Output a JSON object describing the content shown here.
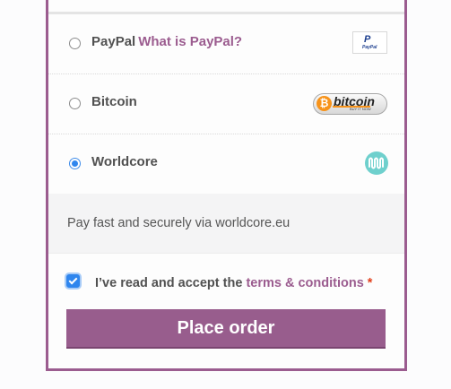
{
  "payment_methods": [
    {
      "label": "PayPal",
      "link": "What is PayPal?",
      "selected": false,
      "icon": "paypal-logo-icon",
      "logo_text": "PayPal"
    },
    {
      "label": "Bitcoin",
      "selected": false,
      "icon": "bitcoin-logo-icon",
      "logo_text": "bitcoin",
      "logo_subtext": "BUY IT NOW"
    },
    {
      "label": "Worldcore",
      "selected": true,
      "icon": "worldcore-logo-icon"
    }
  ],
  "worldcore_description": "Pay fast and securely via worldcore.eu",
  "terms": {
    "prefix": "I’ve read and accept the ",
    "link": "terms & conditions",
    "required_mark": "*",
    "checked": true
  },
  "place_order_label": "Place order",
  "colors": {
    "accent": "#9b5c8f",
    "button": "#985d8d",
    "radio_selected": "#2f86ee",
    "required": "#e2401c"
  }
}
